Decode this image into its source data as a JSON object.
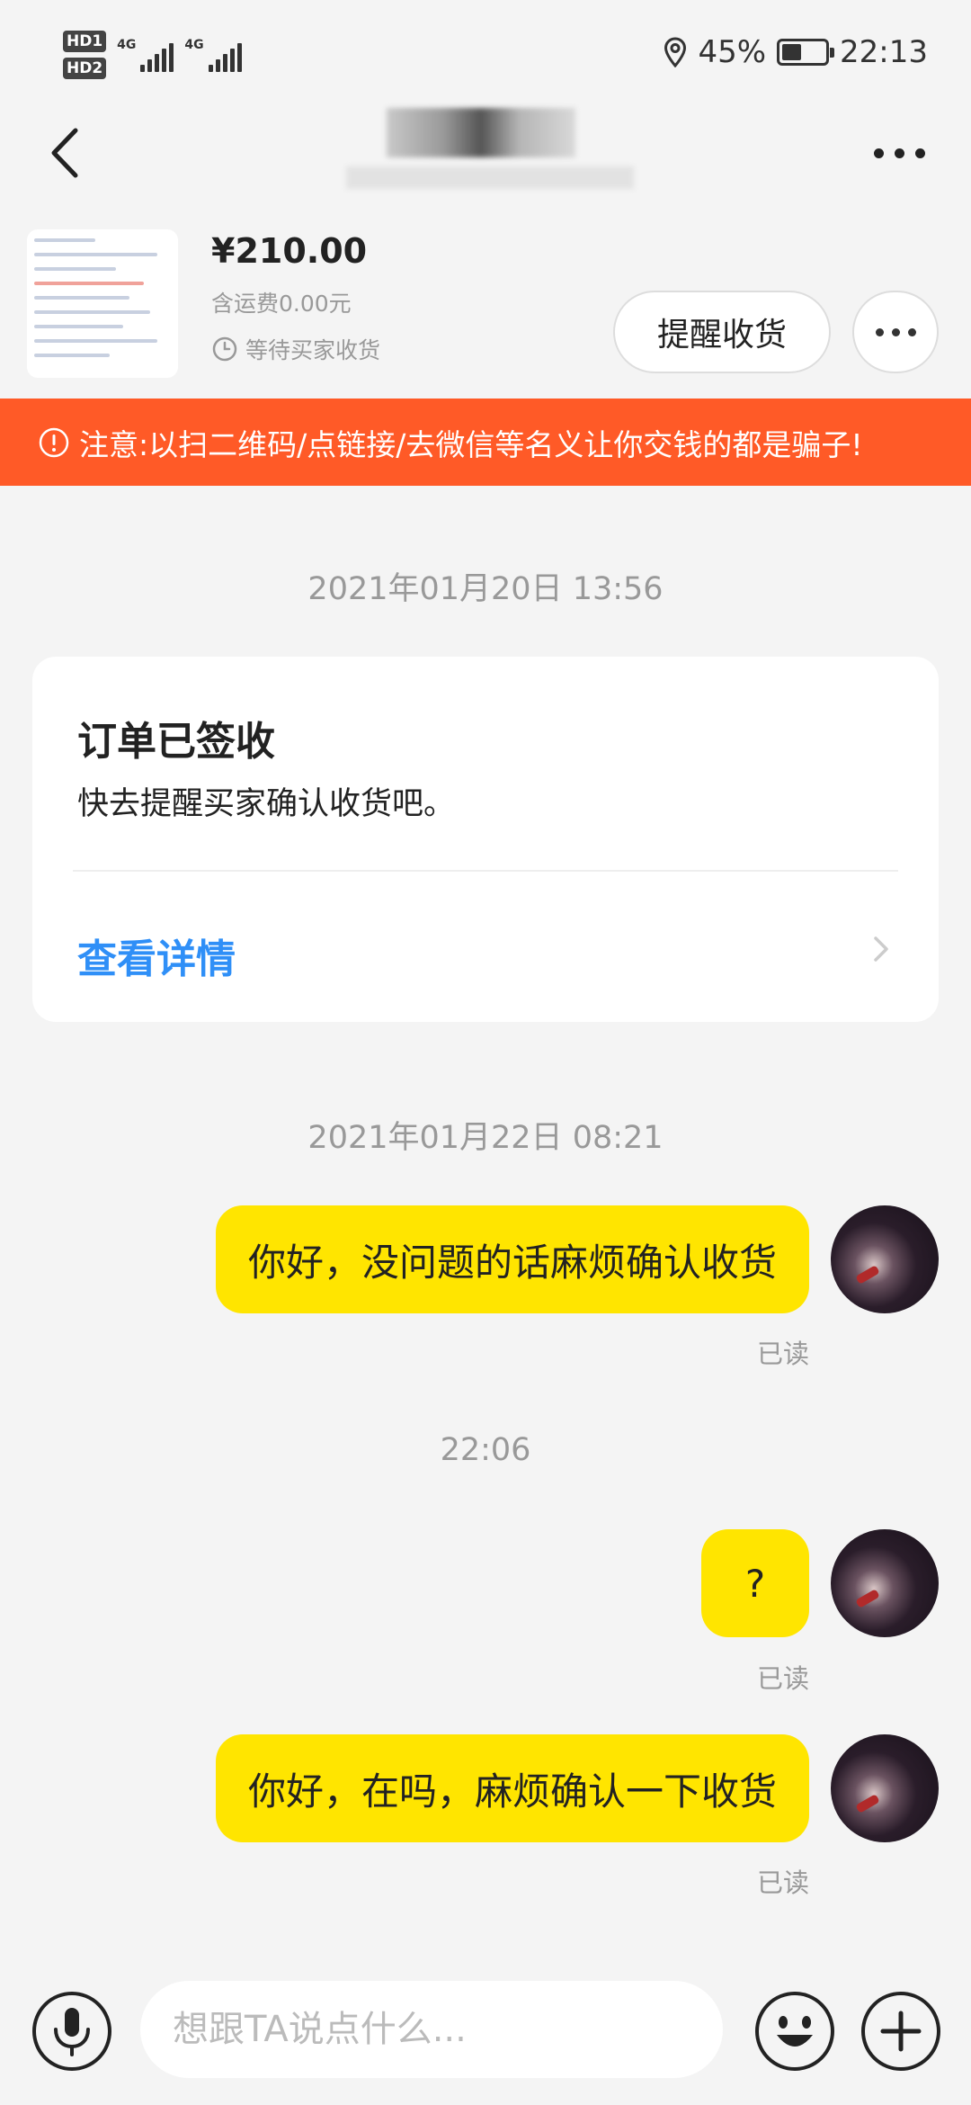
{
  "status_bar": {
    "hd1": "HD1",
    "hd2": "HD2",
    "net1": "4G",
    "net2": "4G",
    "battery_pct": "45%",
    "battery_level": 0.45,
    "time": "22:13",
    "icons": [
      "location-icon",
      "battery-icon",
      "signal-icon"
    ]
  },
  "nav": {
    "back_icon": "chevron-left-icon",
    "more_icon": "more-icon"
  },
  "product": {
    "price": "¥210.00",
    "shipping": "含运费0.00元",
    "status": "等待买家收货",
    "remind_button": "提醒收货"
  },
  "warning": {
    "text": "注意:以扫二维码/点链接/去微信等名义让你交钱的都是骗子!",
    "color": "#ff5a27"
  },
  "chat": {
    "time1": "2021年01月20日 13:56",
    "card": {
      "title": "订单已签收",
      "desc": "快去提醒买家确认收货吧。",
      "link": "查看详情"
    },
    "time2": "2021年01月22日 08:21",
    "messages": [
      {
        "text": "你好，没问题的话麻烦确认收货",
        "status": "已读"
      },
      {
        "text": "?",
        "status": "已读"
      },
      {
        "text": "你好，在吗，麻烦确认一下收货",
        "status": "已读"
      }
    ],
    "time3": "22:06"
  },
  "input": {
    "placeholder": "想跟TA说点什么..."
  },
  "colors": {
    "bubble": "#ffe500",
    "link": "#2f8ff7",
    "background": "#f4f4f4"
  }
}
